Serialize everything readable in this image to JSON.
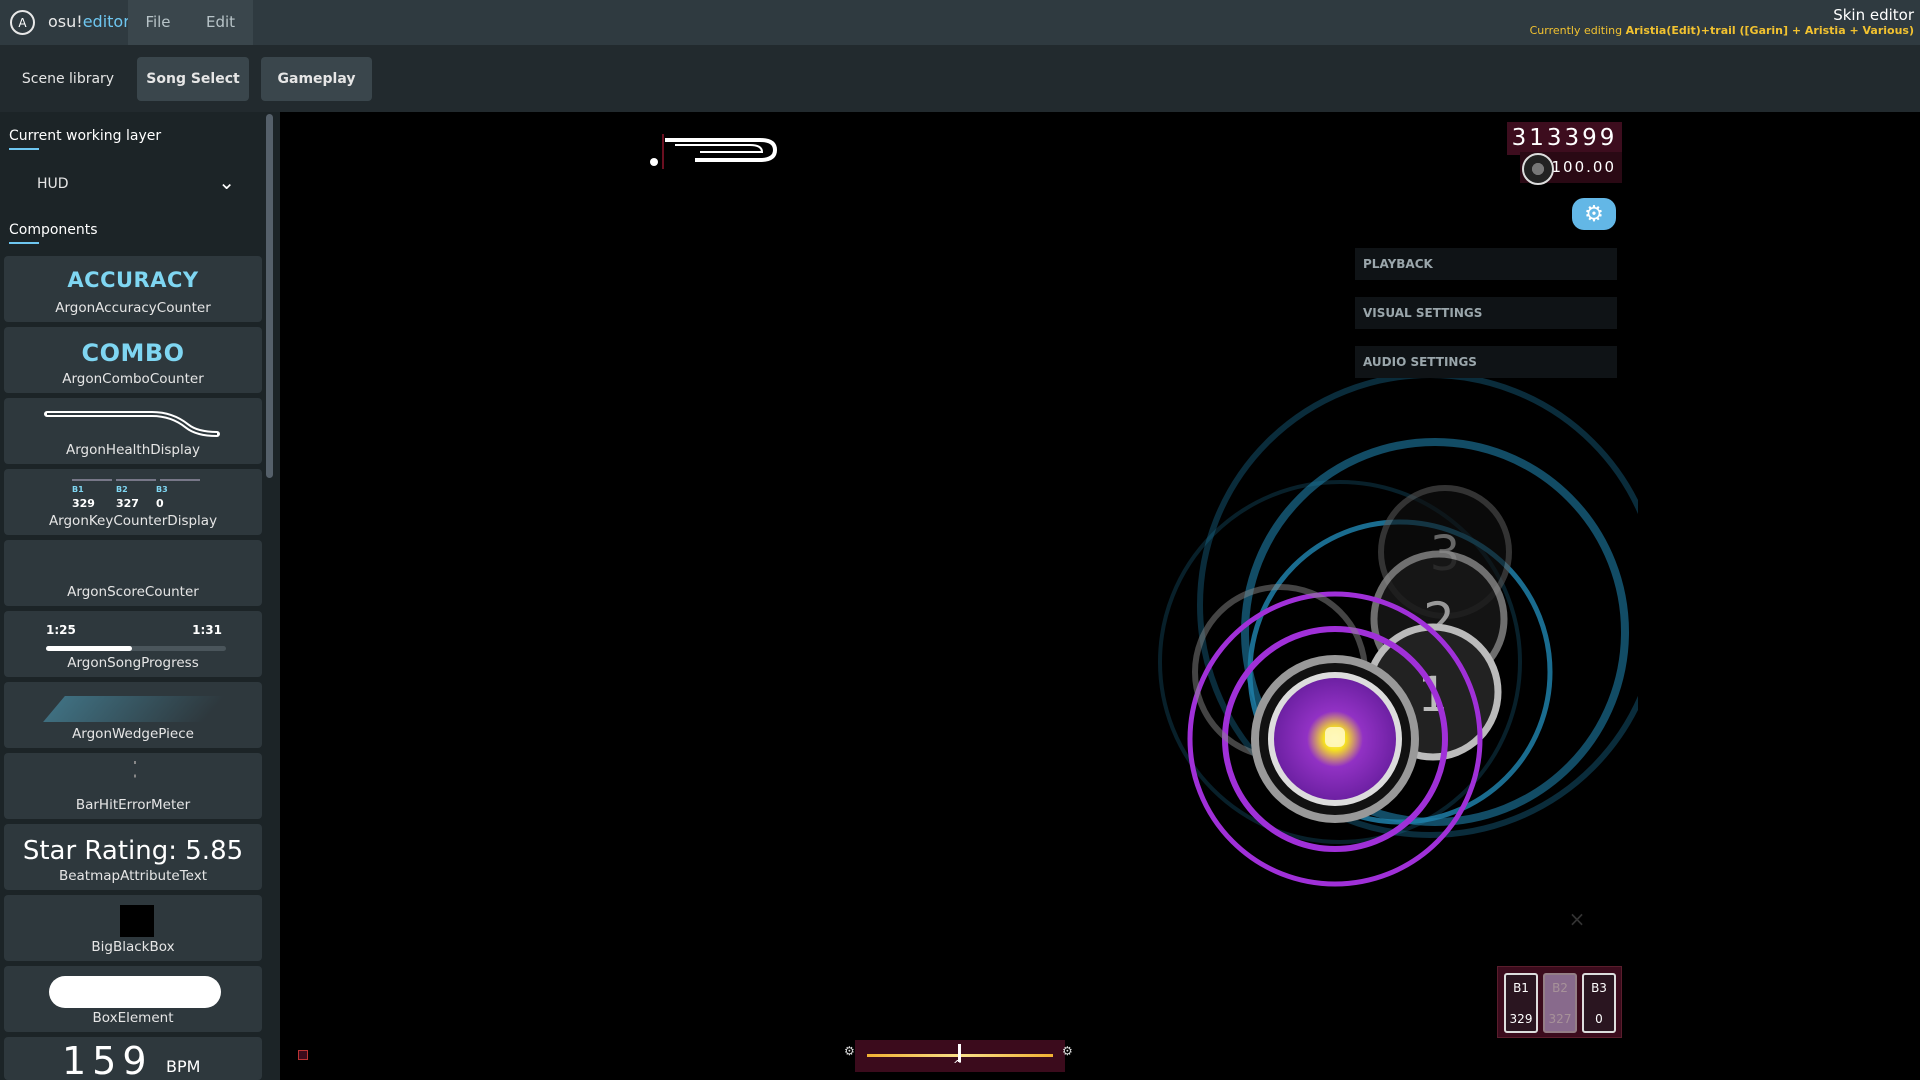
{
  "app": {
    "brand_a": "osu!",
    "brand_b": "editor",
    "logo_glyph": "A"
  },
  "menu": {
    "file": "File",
    "edit": "Edit"
  },
  "title": {
    "main": "Skin editor",
    "editing_prefix": "Currently editing ",
    "editing_value": "Aristia(Edit)+trail ([Garin] + Aristia + Various)"
  },
  "scenes": {
    "library": "Scene library",
    "song_select": "Song Select",
    "gameplay": "Gameplay"
  },
  "sidebar": {
    "layer_label": "Current working layer",
    "layer_value": "HUD",
    "components_label": "Components",
    "components": [
      {
        "name": "ArgonAccuracyCounter",
        "preview": "ACCURACY"
      },
      {
        "name": "ArgonComboCounter",
        "preview": "COMBO"
      },
      {
        "name": "ArgonHealthDisplay",
        "preview": ""
      },
      {
        "name": "ArgonKeyCounterDisplay",
        "preview": ""
      },
      {
        "name": "ArgonScoreCounter",
        "preview": ""
      },
      {
        "name": "ArgonSongProgress",
        "preview": ""
      },
      {
        "name": "ArgonWedgePiece",
        "preview": ""
      },
      {
        "name": "BarHitErrorMeter",
        "preview": ""
      },
      {
        "name": "BeatmapAttributeText",
        "preview": "Star Rating: 5.85"
      },
      {
        "name": "BigBlackBox",
        "preview": ""
      },
      {
        "name": "BoxElement",
        "preview": ""
      },
      {
        "name": "",
        "preview": "159"
      }
    ],
    "key_preview": {
      "labels": [
        "B1",
        "B2",
        "B3"
      ],
      "values": [
        "329",
        "327",
        "0"
      ]
    },
    "progress_preview": {
      "current": "1:25",
      "total": "1:31",
      "fraction": 0.48
    },
    "bpm_unit": "BPM"
  },
  "game": {
    "score": "313399",
    "accuracy": "100.00",
    "settings": [
      "PLAYBACK",
      "VISUAL SETTINGS",
      "AUDIO SETTINGS"
    ],
    "circle_numbers": [
      "3",
      "2",
      "1"
    ],
    "keys": [
      {
        "label": "B1",
        "value": "329"
      },
      {
        "label": "B2",
        "value": "327"
      },
      {
        "label": "B3",
        "value": "0"
      }
    ]
  },
  "colors": {
    "accent": "#6ec6f0",
    "title_highlight": "#f2c230",
    "hud_panel": "#3d0d1e",
    "circle_purple": "#a030d8",
    "circle_blue": "#1e7fa8"
  }
}
